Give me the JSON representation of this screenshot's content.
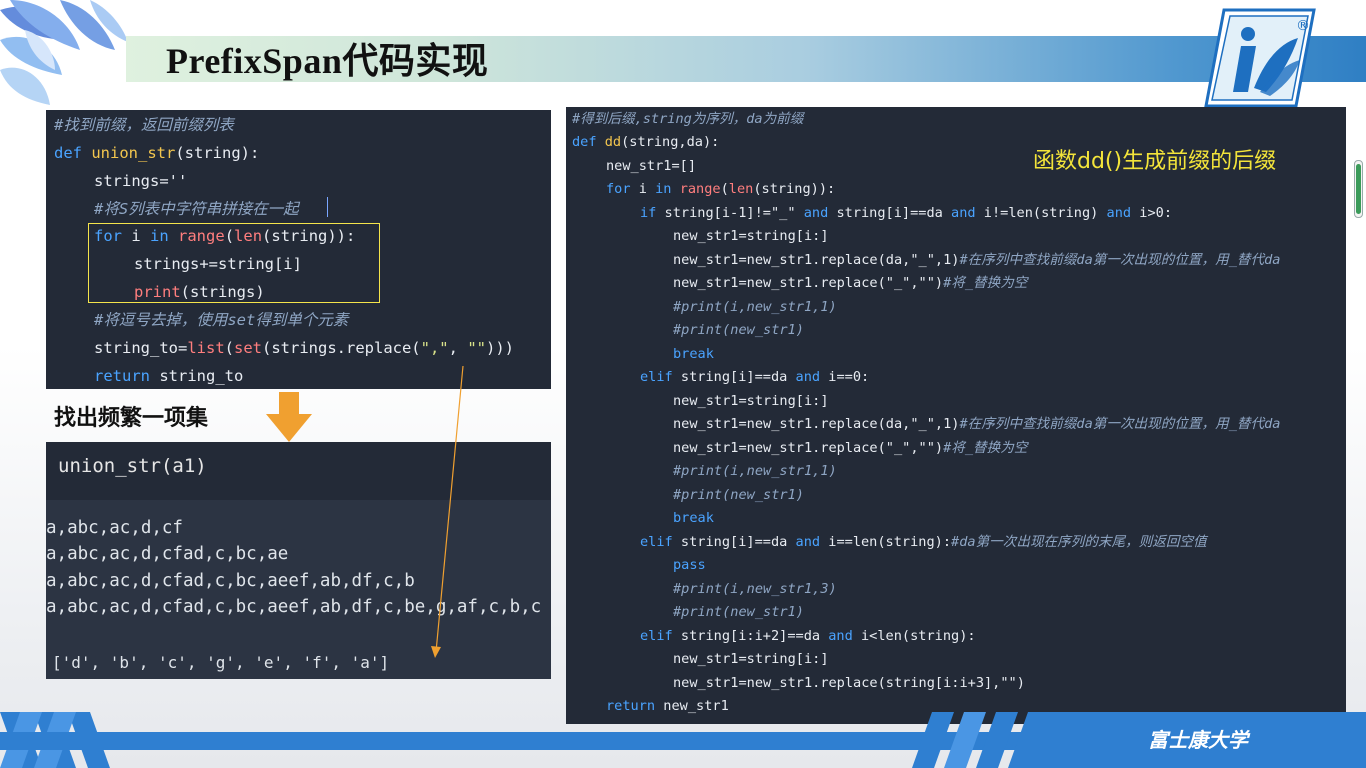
{
  "slide": {
    "title": "PrefixSpan代码实现",
    "school": "富士康大学",
    "heading_frequent": "找出频繁一项集",
    "annotation": "函数dd()生成前缀的后缀",
    "logo_mark": "®"
  },
  "colors": {
    "code_bg": "#232a37",
    "accent_blue": "#2f7fd1",
    "highlight_box": "#f4e44b",
    "annotation": "#f3e43a",
    "arrow": "#f0a030"
  },
  "icons": [
    "petal-decoration-icon",
    "logo-icon",
    "down-arrow-icon"
  ],
  "code_union": {
    "c1": "#找到前缀，返回前缀列表",
    "l2_def": "def ",
    "l2_fn": "union_str",
    "l2_args": "(string):",
    "l3": "strings=''",
    "c4": "#将S列表中字符串拼接在一起",
    "l5_for": "for",
    "l5_i": " i ",
    "l5_in": "in",
    "l5_range": "range",
    "l5_len": "len",
    "l5_rest": "(string)):",
    "l5_open": "(",
    "l6": "strings+=string[i]",
    "l7_print": "print",
    "l7_rest": "(strings)",
    "c8": "#将逗号去掉，使用set得到单个元素",
    "l9_a": "string_to=",
    "l9_list": "list",
    "l9_set": "set",
    "l9_b": "(strings.replace(",
    "l9_s1": "\",\"",
    "l9_c": ", ",
    "l9_s2": "\"\"",
    "l9_d": ")))",
    "l9_open": "(",
    "l10_ret": "return",
    "l10_rest": " string_to"
  },
  "result": {
    "call": "union_str(a1)",
    "lines": [
      "a,abc,ac,d,cf",
      "a,abc,ac,d,cfad,c,bc,ae",
      "a,abc,ac,d,cfad,c,bc,aeef,ab,df,c,b",
      "a,abc,ac,d,cfad,c,bc,aeef,ab,df,c,be,g,af,c,b,c"
    ],
    "set_output": "['d', 'b', 'c', 'g', 'e', 'f', 'a']"
  },
  "code_dd": {
    "c1": "#得到后缀,string为序列，da为前缀",
    "def_kw": "def ",
    "def_fn": "dd",
    "def_args": "(string,da):",
    "new_init": "new_str1=[]",
    "for_kw": "for",
    "for_i": " i ",
    "in_kw": "in",
    "range_fn": "range",
    "len_fn": "len",
    "for_rest": "(string)):",
    "if_kw": "if",
    "if_a": " string[i-1]!=\"_\" ",
    "and_kw": "and",
    "if_b": " string[i]==da ",
    "if_c": " i!=len(string) ",
    "if_d": " i>0:",
    "slice": "new_str1=string[i:]",
    "rep1": "new_str1=new_str1.replace(da,\"_\",1)",
    "cm_rep1": "#在序列中查找前缀da第一次出现的位置，用_替代da",
    "rep2": "new_str1=new_str1.replace(\"_\",\"\")",
    "cm_rep2": "#将_替换为空",
    "cm_print1": "#print(i,new_str1,1)",
    "cm_print2": "#print(new_str1)",
    "break_kw": "break",
    "elif_kw": "elif",
    "elif1": " string[i]==da ",
    "elif1_b": " i==0:",
    "elif2": " string[i]==da ",
    "elif2_b": " i==len(string):",
    "cm_elif2": "#da第一次出现在序列的末尾，则返回空值",
    "pass_kw": "pass",
    "cm_print3": "#print(i,new_str1,3)",
    "elif3": " string[i:i+2]==da ",
    "elif3_b": " i<len(string):",
    "rep3": "new_str1=new_str1.replace(string[i:i+3],\"\")",
    "return_kw": "return",
    "return_rest": " new_str1"
  }
}
